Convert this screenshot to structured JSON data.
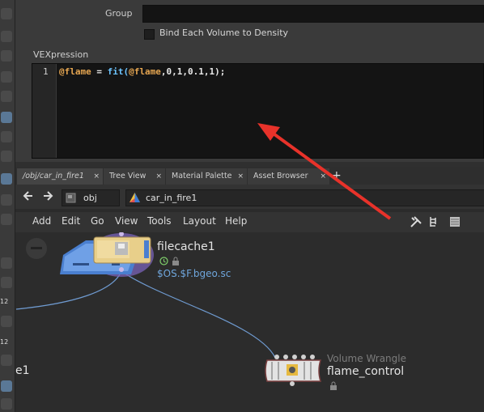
{
  "params": {
    "group_label": "Group",
    "group_value": "",
    "bind_label": "Bind Each Volume to Density",
    "bind_checked": false,
    "vex_label": "VEXpression",
    "vex_line": "1",
    "vex_code": {
      "t1": "@flame",
      "t2": " = ",
      "t3": "fit",
      "t4": "(",
      "t5": "@flame",
      "t6": ",0,1,0.1,1);"
    }
  },
  "left_shelf": {
    "numbers": [
      "12",
      "12",
      "12"
    ],
    "edge_text": "e1"
  },
  "tabs": [
    {
      "label": "/obj/car_in_fire1",
      "close": "×"
    },
    {
      "label": "Tree View",
      "close": "×"
    },
    {
      "label": "Material Palette",
      "close": "×"
    },
    {
      "label": "Asset Browser",
      "close": "×"
    }
  ],
  "tab_add": "+",
  "path": {
    "level1": "obj",
    "level2": "car_in_fire1"
  },
  "menu": [
    "Add",
    "Edit",
    "Go",
    "View",
    "Tools",
    "Layout",
    "Help"
  ],
  "nodes": {
    "filecache": {
      "name": "filecache1",
      "subtitle": "$OS.$F.bgeo.sc"
    },
    "wrangle": {
      "type": "Volume Wrangle",
      "name": "flame_control"
    }
  },
  "colors": {
    "arrow": "#e8322a",
    "wire": "#6f9bd1",
    "vex_attr": "#e6a651",
    "vex_func": "#6cc4ff",
    "subtitle": "#6fa6dc"
  }
}
